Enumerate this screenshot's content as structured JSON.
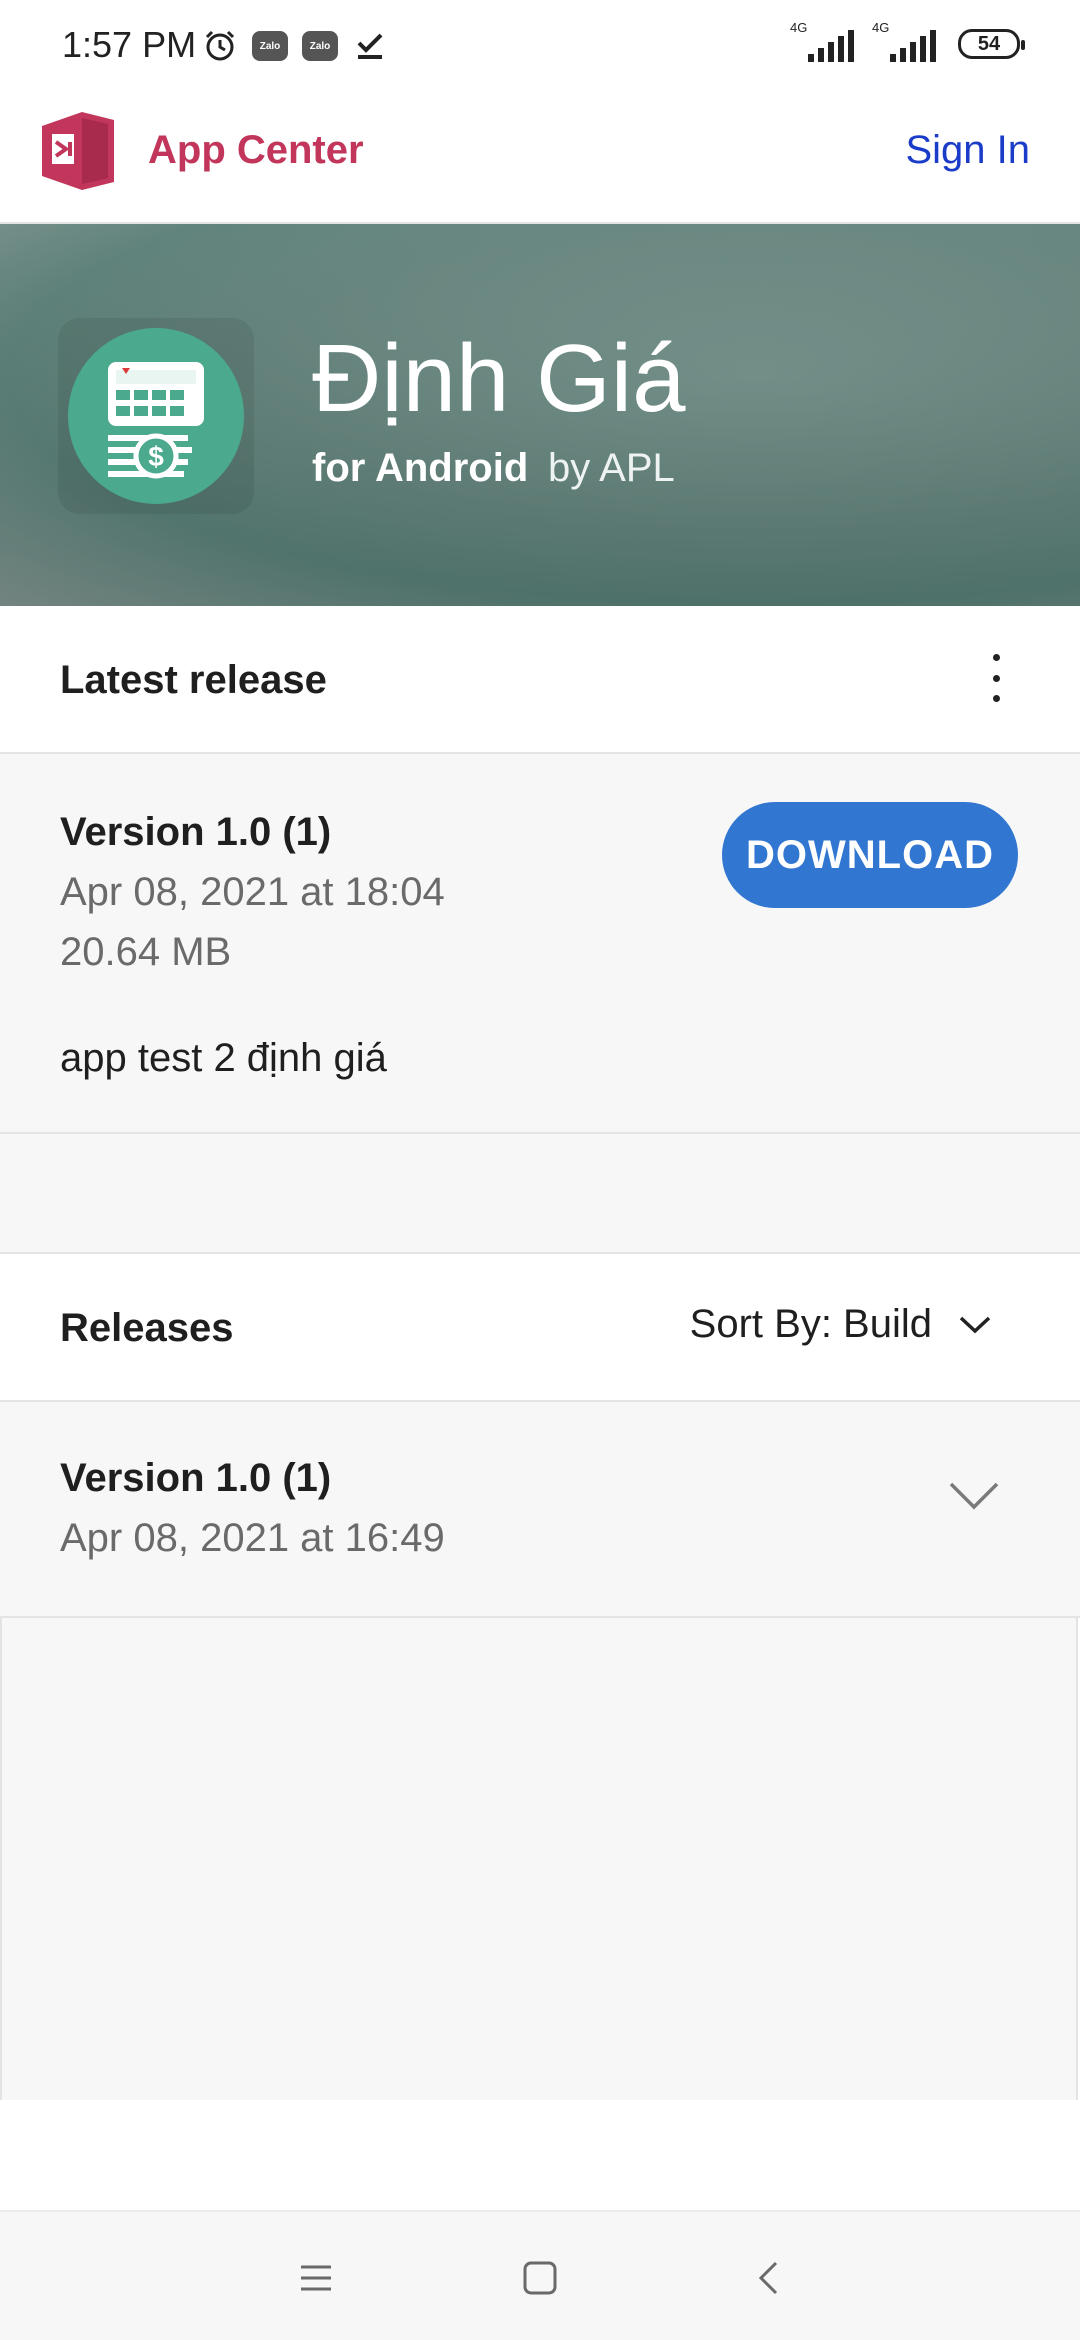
{
  "status_bar": {
    "time": "1:57 PM",
    "zalo1": "Zalo",
    "zalo2": "Zalo",
    "network1": "4G",
    "network2": "4G",
    "battery": "54"
  },
  "header": {
    "brand": "App Center",
    "sign_in": "Sign In",
    "brand_color": "#c2365b",
    "link_color": "#1a3cc9"
  },
  "app": {
    "title": "Định Giá",
    "platform": "for Android",
    "by": "by APL",
    "icon_color": "#4ba98d"
  },
  "latest": {
    "section_title": "Latest release",
    "version": "Version 1.0 (1)",
    "date": "Apr 08, 2021 at 18:04",
    "size": "20.64 MB",
    "notes": "app test 2 định giá",
    "download_label": "DOWNLOAD",
    "download_color": "#3176d0"
  },
  "releases": {
    "section_title": "Releases",
    "sort_label": "Sort By: Build",
    "items": [
      {
        "version": "Version 1.0 (1)",
        "date": "Apr 08, 2021 at 16:49"
      }
    ]
  },
  "icons": {
    "alarm": "alarm-icon",
    "check": "check-download-icon",
    "menu": "menu-icon",
    "home": "home-icon",
    "back": "back-icon",
    "kebab": "more-options-icon",
    "chevron": "chevron-down-icon"
  }
}
